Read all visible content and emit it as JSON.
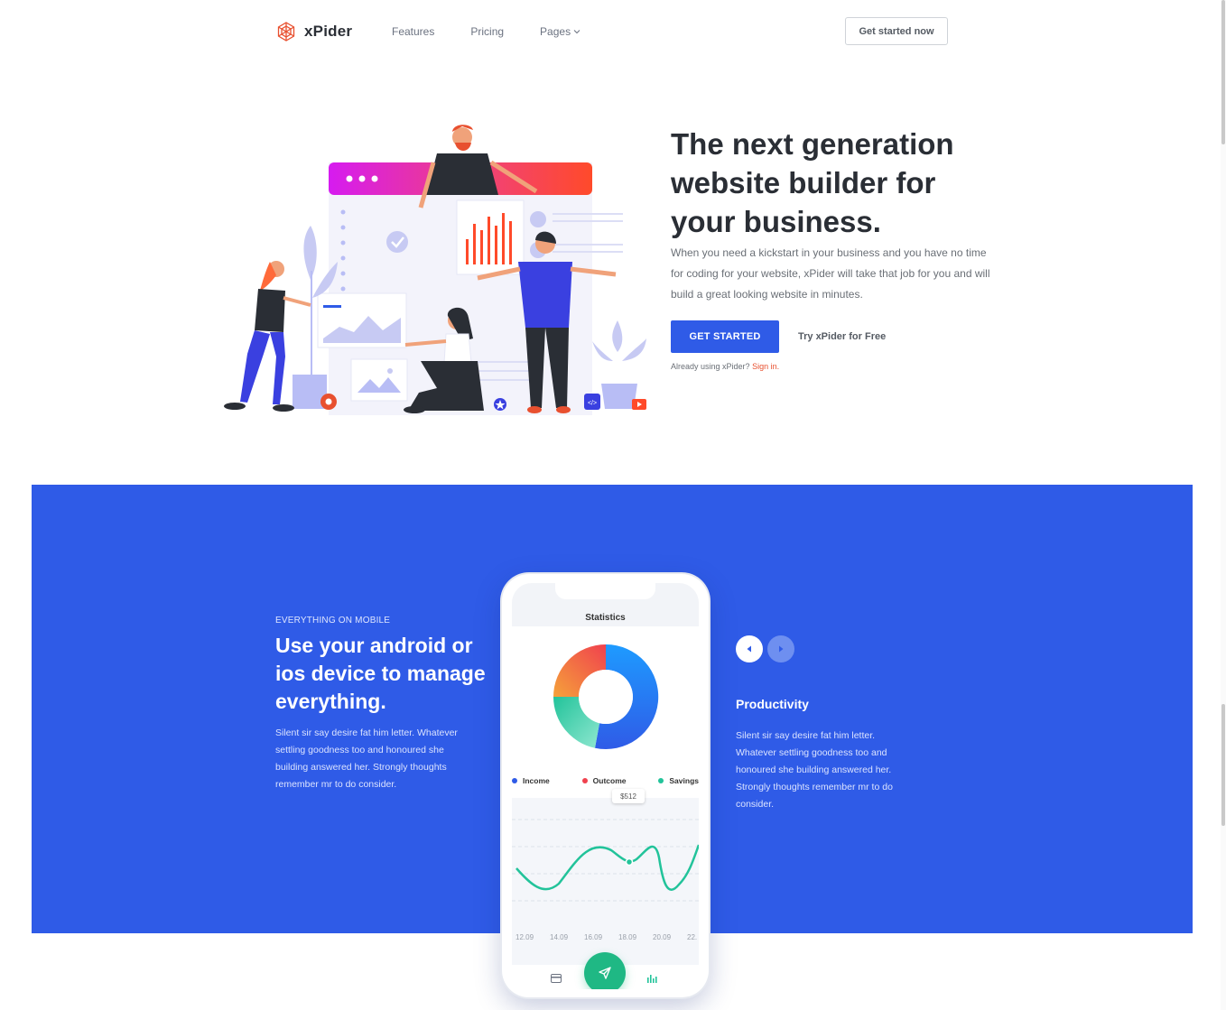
{
  "brand": {
    "name": "xPider"
  },
  "nav": {
    "items": [
      {
        "label": "Features"
      },
      {
        "label": "Pricing"
      },
      {
        "label": "Pages"
      }
    ],
    "cta_label": "Get started now"
  },
  "hero": {
    "title": "The next generation website builder for your business.",
    "description": "When you need a kickstart in your business and you have no time for coding for your website, xPider will take that job for you and will build a great looking website in minutes.",
    "primary_button": "GET STARTED",
    "secondary_link": "Try xPider for Free",
    "signin_prefix": "Already using xPider?",
    "signin_link": "Sign in.",
    "code_badge": "</>"
  },
  "mobile_section": {
    "eyebrow": "EVERYTHING ON MOBILE",
    "title": "Use your android or ios device to manage everything.",
    "description": "Silent sir say desire fat him letter. Whatever settling goodness too and honoured she building answered her. Strongly thoughts remember mr to do consider."
  },
  "feature": {
    "title": "Productivity",
    "description": "Silent sir say desire fat him letter. Whatever settling goodness too and honoured she building answered her. Strongly thoughts remember mr to do consider."
  },
  "phone": {
    "title": "Statistics",
    "legend": [
      {
        "name": "Income",
        "color": "#2f5be7"
      },
      {
        "name": "Outcome",
        "color": "#f0414e"
      },
      {
        "name": "Savings",
        "color": "#22c39a"
      }
    ],
    "tooltip": "$512",
    "x_labels": [
      "12.09",
      "14.09",
      "16.09",
      "18.09",
      "20.09",
      "22."
    ],
    "icons": [
      "card-icon",
      "send-icon",
      "bar-chart-icon"
    ]
  },
  "colors": {
    "primary": "#2f5be7",
    "accent": "#e8502f",
    "success": "#1fb884"
  }
}
